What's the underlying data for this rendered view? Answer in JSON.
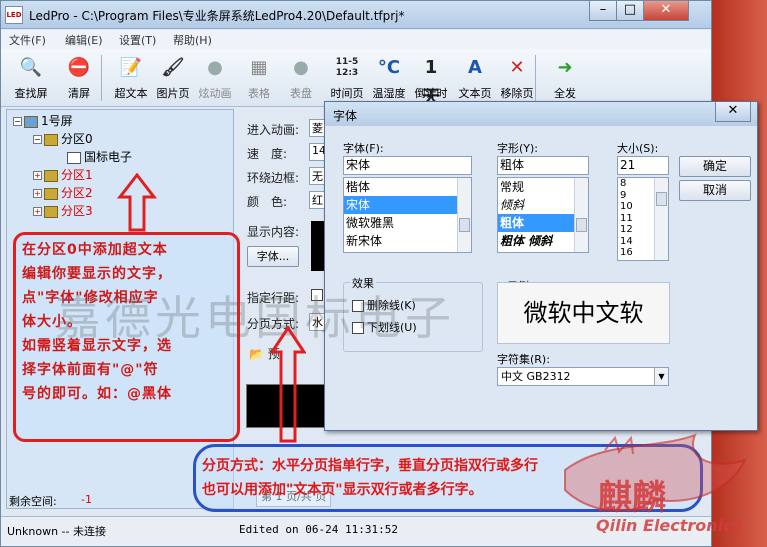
{
  "window": {
    "title": "LedPro - C:\\Program Files\\专业条屏系统LedPro4.20\\Default.tfprj*",
    "app_icon": "LED"
  },
  "title_buttons": {
    "minimize": "–",
    "maximize": "□",
    "close": "✕"
  },
  "menu": [
    "文件(F)",
    "编辑(E)",
    "设置(T)",
    "帮助(H)"
  ],
  "toolbar": [
    {
      "label": "查找屏",
      "icon": "magnifier-icon",
      "glyph": "🔍"
    },
    {
      "label": "清屏",
      "icon": "stop-icon",
      "glyph": "⛔"
    },
    {
      "label": "超文本",
      "icon": "hypertext-icon",
      "glyph": "📝"
    },
    {
      "label": "图片页",
      "icon": "picture-icon",
      "glyph": "🖌"
    },
    {
      "label": "炫动画",
      "icon": "animation-icon",
      "glyph": "●"
    },
    {
      "label": "表格",
      "icon": "table-icon",
      "glyph": "▦"
    },
    {
      "label": "表盘",
      "icon": "clock-dial-icon",
      "glyph": "●"
    },
    {
      "label": "时间页",
      "icon": "time-icon",
      "glyph": "11-5\n12:3"
    },
    {
      "label": "温湿度",
      "icon": "temperature-icon",
      "glyph": "°C"
    },
    {
      "label": "倒计时",
      "icon": "countdown-icon",
      "glyph": "1天"
    },
    {
      "label": "文本页",
      "icon": "text-icon",
      "glyph": "A"
    },
    {
      "label": "移除页",
      "icon": "remove-icon",
      "glyph": "✕"
    },
    {
      "label": "全发",
      "icon": "send-all-icon",
      "glyph": "➜"
    }
  ],
  "tree": {
    "root": "1号屏",
    "zone0": "分区0",
    "item": "国标电子",
    "zone1": "分区1",
    "zone2": "分区2",
    "zone3": "分区3"
  },
  "note1": [
    "在分区0中添加超文本",
    "编辑你要显示的文字，",
    "点\"字体\"修改相应字",
    "体大小。",
    "如需竖着显示文字，选",
    "择字体前面有\"@\"符",
    "号的即可。如：@黑体"
  ],
  "props": {
    "enter_anim": "进入动画:",
    "enter_anim_val": "菱",
    "speed": "速　度:",
    "speed_val": "14",
    "border": "环绕边框:",
    "border_val": "无",
    "color": "颜　色:",
    "color_val": "红",
    "display": "显示内容:",
    "font_btn": "字体...",
    "spacing": "指定行距:",
    "paging": "分页方式:",
    "paging_val": "水",
    "preview": "预"
  },
  "status": {
    "remain_label": "剩余空间:",
    "remain_value": "-1",
    "conn": "Unknown -- 未连接",
    "edited": "Edited on 06-24 11:31:52",
    "page": "第 1 页/共 页"
  },
  "dialog": {
    "title": "字体",
    "close": "✕",
    "font_label": "字体(F):",
    "font_value": "宋体",
    "font_list": [
      "楷体",
      "宋体",
      "微软雅黑",
      "新宋体"
    ],
    "style_label": "字形(Y):",
    "style_value": "粗体",
    "style_list": [
      "常规",
      "倾斜",
      "粗体",
      "粗体 倾斜"
    ],
    "size_label": "大小(S):",
    "size_value": "21",
    "size_list": [
      "8",
      "9",
      "10",
      "11",
      "12",
      "14",
      "16"
    ],
    "ok": "确定",
    "cancel": "取消",
    "effects": "效果",
    "strike": "删除线(K)",
    "underline": "下划线(U)",
    "sample_label": "示例",
    "sample_text": "微软中文软",
    "charset_label": "字符集(R):",
    "charset_value": "中文 GB2312"
  },
  "note2": [
    "分页方式：水平分页指单行字，垂直分页指双行或多行",
    "也可以用添加\"文本页\"显示双行或者多行字。"
  ],
  "watermark": "嘉德光电国标电子",
  "logo": {
    "cn": "麒麟",
    "en": "Qilin Electronics"
  },
  "colors": {
    "note_red": "#d01818",
    "note_blue": "#2a52c8",
    "select": "#3399ff"
  }
}
